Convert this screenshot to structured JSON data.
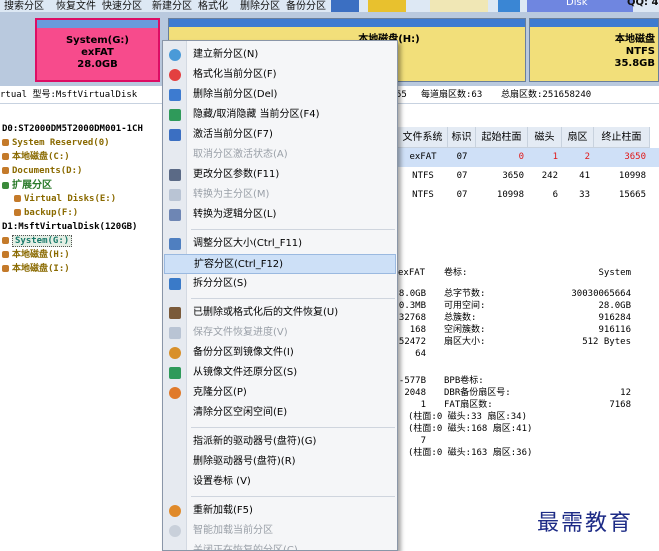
{
  "toolbar": {
    "items": [
      "搜索分区",
      "恢复文件",
      "快速分区",
      "新建分区",
      "格式化",
      "删除分区",
      "备份分区"
    ],
    "right_badge": "QQ: 4",
    "right_label": "Disk"
  },
  "diskmap": {
    "partitions": [
      {
        "name": "System(G:)",
        "fs": "exFAT",
        "size": "28.0GB"
      },
      {
        "name": "本地磁盘(H:)",
        "fs": "",
        "size": "3"
      },
      {
        "name": "本地磁盘",
        "fs": "NTFS",
        "size": "35.8GB"
      }
    ]
  },
  "infoline": {
    "left": "rtual  型号:MsftVirtualDisk",
    "heads": "55",
    "sectors_per_track": "每道扇区数:63",
    "total_sectors": "总扇区数:251658240"
  },
  "tree": {
    "items": [
      {
        "label": "D0:ST2000DM5T2000DM001-1CH"
      },
      {
        "label": "System Reserved(0)"
      },
      {
        "label": "本地磁盘(C:)"
      },
      {
        "label": "Documents(D:)"
      },
      {
        "label": "扩展分区"
      },
      {
        "label": "Virtual Disks(E:)"
      },
      {
        "label": "backup(F:)"
      },
      {
        "label": "D1:MsftVirtualDisk(120GB)"
      },
      {
        "label": "System(G:)"
      },
      {
        "label": "本地磁盘(H:)"
      },
      {
        "label": "本地磁盘(I:)"
      }
    ]
  },
  "table": {
    "columns": [
      "文件系统",
      "标识",
      "起始柱面",
      "磁头",
      "扇区",
      "终止柱面"
    ],
    "rows": [
      [
        "exFAT",
        "07",
        "0",
        "1",
        "2",
        "3650"
      ],
      [
        "NTFS",
        "07",
        "3650",
        "242",
        "41",
        "10998"
      ],
      [
        "NTFS",
        "07",
        "10998",
        "6",
        "33",
        "15665"
      ]
    ]
  },
  "details": {
    "fs_value": "exFAT",
    "volume_label_key": "卷标:",
    "volume_label_value": "System",
    "left_values": [
      "8.0GB",
      "0.3MB",
      "32768",
      "168",
      "52472",
      "64"
    ],
    "left_values2": [
      "-577B",
      "2048",
      "1",
      "(柱面:0 磁头:33 扇区:34)",
      "(柱面:0 磁头:168 扇区:41)",
      "7",
      "(柱面:0 磁头:163 扇区:36)"
    ],
    "stats": [
      {
        "key": "总字节数:",
        "value": "30030065664"
      },
      {
        "key": "可用空间:",
        "value": "28.0GB"
      },
      {
        "key": "总簇数:",
        "value": "916284"
      },
      {
        "key": "空闲簇数:",
        "value": "916116"
      },
      {
        "key": "扇区大小:",
        "value": "512 Bytes"
      }
    ],
    "bpb_label": "BPB卷标:",
    "bpb_lines": [
      {
        "key": "DBR备份扇区号:",
        "value": "12"
      },
      {
        "key": "FAT扇区数:",
        "value": "7168"
      }
    ]
  },
  "menu": {
    "items": [
      {
        "label": "建立新分区(N)",
        "disabled": false
      },
      {
        "label": "格式化当前分区(F)",
        "disabled": false
      },
      {
        "label": "删除当前分区(Del)",
        "disabled": false
      },
      {
        "label": "隐藏/取消隐藏 当前分区(F4)",
        "disabled": false
      },
      {
        "label": "激活当前分区(F7)",
        "disabled": false
      },
      {
        "label": "取消分区激活状态(A)",
        "disabled": true
      },
      {
        "label": "更改分区参数(F11)",
        "disabled": false
      },
      {
        "label": "转换为主分区(M)",
        "disabled": true
      },
      {
        "label": "转换为逻辑分区(L)",
        "disabled": false
      },
      {
        "label": "调整分区大小(Ctrl_F11)",
        "disabled": false
      },
      {
        "label": "扩容分区(Ctrl_F12)",
        "disabled": false
      },
      {
        "label": "拆分分区(S)",
        "disabled": false
      },
      {
        "label": "已删除或格式化后的文件恢复(U)",
        "disabled": false
      },
      {
        "label": "保存文件恢复进度(V)",
        "disabled": true
      },
      {
        "label": "备份分区到镜像文件(I)",
        "disabled": false
      },
      {
        "label": "从镜像文件还原分区(S)",
        "disabled": false
      },
      {
        "label": "克隆分区(P)",
        "disabled": false
      },
      {
        "label": "清除分区空闲空间(E)",
        "disabled": false
      },
      {
        "label": "指派新的驱动器号(盘符)(G)",
        "disabled": false
      },
      {
        "label": "删除驱动器号(盘符)(R)",
        "disabled": false
      },
      {
        "label": "设置卷标 (V)",
        "disabled": false
      },
      {
        "label": "重新加载(F5)",
        "disabled": false
      },
      {
        "label": "智能加载当前分区",
        "disabled": true
      },
      {
        "label": "关闭正在恢复的分区(C)",
        "disabled": true
      }
    ]
  },
  "watermark": "最需教育"
}
